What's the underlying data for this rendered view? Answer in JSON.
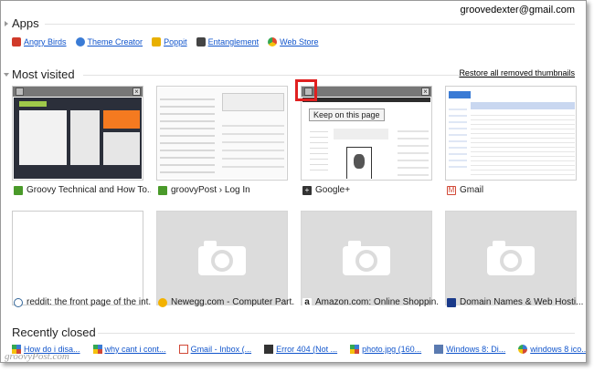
{
  "user": {
    "email": "groovedexter@gmail.com"
  },
  "apps": {
    "title": "Apps",
    "items": [
      {
        "label": "Angry Birds",
        "icon": "angry-birds-icon",
        "color": "#d03a2a"
      },
      {
        "label": "Theme Creator",
        "icon": "theme-creator-icon",
        "color": "#3a7bd5"
      },
      {
        "label": "Poppit",
        "icon": "poppit-icon",
        "color": "#e8b000"
      },
      {
        "label": "Entanglement",
        "icon": "entanglement-icon",
        "color": "#444444"
      },
      {
        "label": "Web Store",
        "icon": "web-store-icon",
        "color": "#e04a2f"
      }
    ]
  },
  "most_visited": {
    "title": "Most visited",
    "restore_label": "Restore all removed thumbnails",
    "tooltip": "Keep on this page",
    "tiles": [
      {
        "caption": "Groovy Technical and How To...",
        "favicon": "groovypost-favicon",
        "color": "#4a9a2a"
      },
      {
        "caption": "groovyPost › Log In",
        "favicon": "groovypost-favicon",
        "color": "#4a9a2a"
      },
      {
        "caption": "Google+",
        "favicon": "google-plus-favicon",
        "color": "#333333"
      },
      {
        "caption": "Gmail",
        "favicon": "gmail-favicon",
        "color": "#d14836"
      },
      {
        "caption": "reddit: the front page of the int...",
        "favicon": "reddit-favicon",
        "color": "#336699"
      },
      {
        "caption": "Newegg.com - Computer Part...",
        "favicon": "newegg-favicon",
        "color": "#f3b200"
      },
      {
        "caption": "Amazon.com: Online Shoppin...",
        "favicon": "amazon-favicon",
        "color": "#222222"
      },
      {
        "caption": "Domain Names & Web Hosti...",
        "favicon": "domain-favicon",
        "color": "#1a3a8a"
      }
    ]
  },
  "recently_closed": {
    "title": "Recently closed",
    "items": [
      {
        "label": "How do i disa...",
        "icon": "google-favicon",
        "color": "#3a7bd5"
      },
      {
        "label": "why cant i cont...",
        "icon": "google-favicon",
        "color": "#3a7bd5"
      },
      {
        "label": "Gmail - Inbox (...",
        "icon": "gmail-favicon",
        "color": "#d14836"
      },
      {
        "label": "Error 404 (Not ...",
        "icon": "google-plus-favicon",
        "color": "#333333"
      },
      {
        "label": "photo.jpg (160...",
        "icon": "google-favicon",
        "color": "#3a7bd5"
      },
      {
        "label": "Windows 8: Di...",
        "icon": "page-favicon",
        "color": "#5a7ab0"
      },
      {
        "label": "windows 8 ico...",
        "icon": "google-favicon",
        "color": "#3a7bd5"
      }
    ]
  },
  "watermark": "groovyPost.com"
}
